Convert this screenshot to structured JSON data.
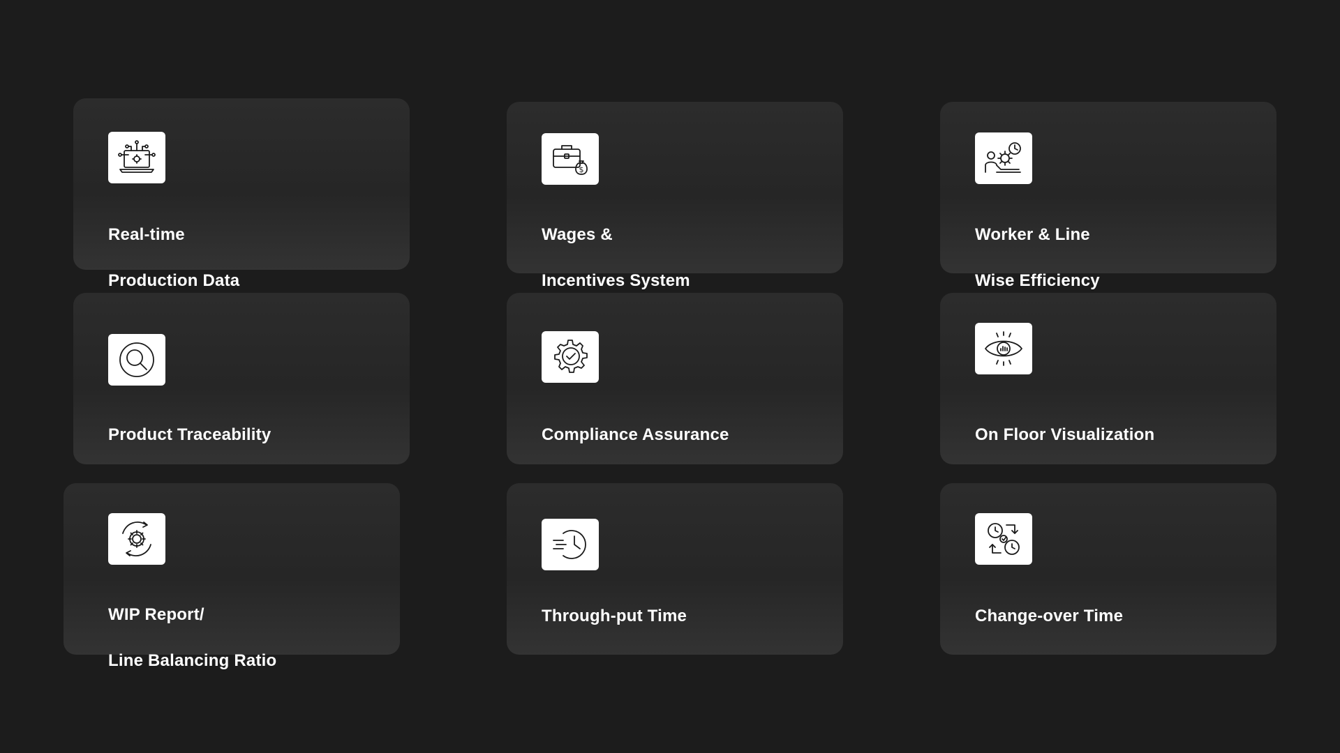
{
  "cards": [
    {
      "line1": "Real-time",
      "line2": "Production Data",
      "icon": "laptop-circuit-icon"
    },
    {
      "line1": "Wages &",
      "line2": " Incentives System",
      "icon": "briefcase-money-icon"
    },
    {
      "line1": "Worker & Line",
      "line2": "Wise Efficiency",
      "icon": "worker-gear-clock-icon"
    },
    {
      "line1": "Product Traceability",
      "line2": "",
      "icon": "magnifier-icon"
    },
    {
      "line1": "Compliance Assurance",
      "line2": "",
      "icon": "gear-check-icon"
    },
    {
      "line1": "On Floor Visualization",
      "line2": "",
      "icon": "eye-chart-icon"
    },
    {
      "line1": "WIP Report/",
      "line2": "Line Balancing Ratio",
      "icon": "gear-cycle-icon"
    },
    {
      "line1": "Through-put Time",
      "line2": "",
      "icon": "fast-clock-icon"
    },
    {
      "line1": "Change-over Time",
      "line2": "",
      "icon": "clock-exchange-icon"
    }
  ]
}
